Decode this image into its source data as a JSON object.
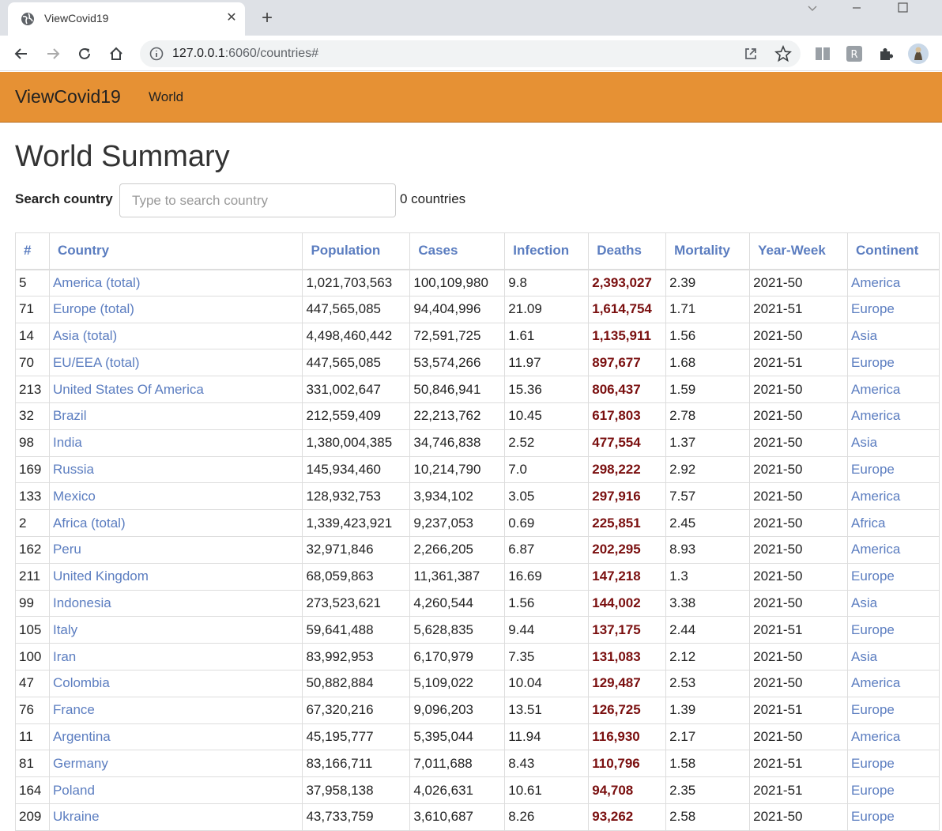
{
  "browser": {
    "tab_title": "ViewCovid19",
    "new_tab_symbol": "+",
    "url_host": "127.0.0.1",
    "url_rest": ":6060/countries#"
  },
  "navbar": {
    "brand": "ViewCovid19",
    "world_link": "World"
  },
  "page": {
    "title": "World Summary",
    "search_label": "Search country",
    "search_placeholder": "Type to search country",
    "search_value": "",
    "count_text": "0 countries"
  },
  "table": {
    "headers": [
      "#",
      "Country",
      "Population",
      "Cases",
      "Infection",
      "Deaths",
      "Mortality",
      "Year-Week",
      "Continent"
    ],
    "rows": [
      [
        "5",
        "America (total)",
        "1,021,703,563",
        "100,109,980",
        "9.8",
        "2,393,027",
        "2.39",
        "2021-50",
        "America"
      ],
      [
        "71",
        "Europe (total)",
        "447,565,085",
        "94,404,996",
        "21.09",
        "1,614,754",
        "1.71",
        "2021-51",
        "Europe"
      ],
      [
        "14",
        "Asia (total)",
        "4,498,460,442",
        "72,591,725",
        "1.61",
        "1,135,911",
        "1.56",
        "2021-50",
        "Asia"
      ],
      [
        "70",
        "EU/EEA (total)",
        "447,565,085",
        "53,574,266",
        "11.97",
        "897,677",
        "1.68",
        "2021-51",
        "Europe"
      ],
      [
        "213",
        "United States Of America",
        "331,002,647",
        "50,846,941",
        "15.36",
        "806,437",
        "1.59",
        "2021-50",
        "America"
      ],
      [
        "32",
        "Brazil",
        "212,559,409",
        "22,213,762",
        "10.45",
        "617,803",
        "2.78",
        "2021-50",
        "America"
      ],
      [
        "98",
        "India",
        "1,380,004,385",
        "34,746,838",
        "2.52",
        "477,554",
        "1.37",
        "2021-50",
        "Asia"
      ],
      [
        "169",
        "Russia",
        "145,934,460",
        "10,214,790",
        "7.0",
        "298,222",
        "2.92",
        "2021-50",
        "Europe"
      ],
      [
        "133",
        "Mexico",
        "128,932,753",
        "3,934,102",
        "3.05",
        "297,916",
        "7.57",
        "2021-50",
        "America"
      ],
      [
        "2",
        "Africa (total)",
        "1,339,423,921",
        "9,237,053",
        "0.69",
        "225,851",
        "2.45",
        "2021-50",
        "Africa"
      ],
      [
        "162",
        "Peru",
        "32,971,846",
        "2,266,205",
        "6.87",
        "202,295",
        "8.93",
        "2021-50",
        "America"
      ],
      [
        "211",
        "United Kingdom",
        "68,059,863",
        "11,361,387",
        "16.69",
        "147,218",
        "1.3",
        "2021-50",
        "Europe"
      ],
      [
        "99",
        "Indonesia",
        "273,523,621",
        "4,260,544",
        "1.56",
        "144,002",
        "3.38",
        "2021-50",
        "Asia"
      ],
      [
        "105",
        "Italy",
        "59,641,488",
        "5,628,835",
        "9.44",
        "137,175",
        "2.44",
        "2021-51",
        "Europe"
      ],
      [
        "100",
        "Iran",
        "83,992,953",
        "6,170,979",
        "7.35",
        "131,083",
        "2.12",
        "2021-50",
        "Asia"
      ],
      [
        "47",
        "Colombia",
        "50,882,884",
        "5,109,022",
        "10.04",
        "129,487",
        "2.53",
        "2021-50",
        "America"
      ],
      [
        "76",
        "France",
        "67,320,216",
        "9,096,203",
        "13.51",
        "126,725",
        "1.39",
        "2021-51",
        "Europe"
      ],
      [
        "11",
        "Argentina",
        "45,195,777",
        "5,395,044",
        "11.94",
        "116,930",
        "2.17",
        "2021-50",
        "America"
      ],
      [
        "81",
        "Germany",
        "83,166,711",
        "7,011,688",
        "8.43",
        "110,796",
        "1.58",
        "2021-51",
        "Europe"
      ],
      [
        "164",
        "Poland",
        "37,958,138",
        "4,026,631",
        "10.61",
        "94,708",
        "2.35",
        "2021-51",
        "Europe"
      ],
      [
        "209",
        "Ukraine",
        "43,733,759",
        "3,610,687",
        "8.26",
        "93,262",
        "2.58",
        "2021-50",
        "Europe"
      ]
    ]
  }
}
